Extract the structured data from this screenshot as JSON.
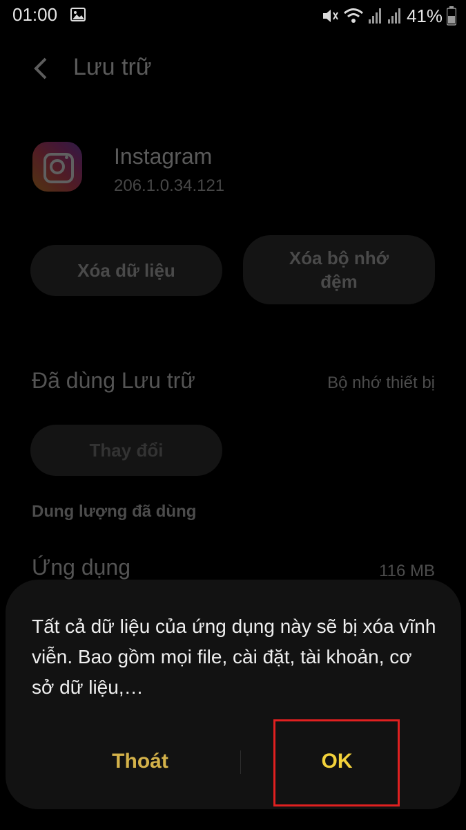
{
  "status_bar": {
    "time": "01:00",
    "battery": "41%",
    "icons": [
      "image-notification-icon",
      "mute-icon",
      "wifi-icon",
      "signal-icon",
      "signal-icon",
      "battery-icon"
    ]
  },
  "header": {
    "title": "Lưu trữ",
    "back_icon": "back-arrow-icon"
  },
  "app": {
    "name": "Instagram",
    "version": "206.1.0.34.121"
  },
  "actions": {
    "clear_data": "Xóa dữ liệu",
    "clear_cache": "Xóa bộ nhớ\nđệm"
  },
  "storage": {
    "used_label": "Đã dùng Lưu trữ",
    "location": "Bộ nhớ thiết bị",
    "change_button": "Thay đổi",
    "section_header": "Dung lượng đã dùng",
    "app_label": "Ứng dụng",
    "app_size": "116 MB"
  },
  "dialog": {
    "message": "Tất cả dữ liệu của ứng dụng này sẽ bị xóa vĩnh viễn. Bao gồm mọi file, cài đặt, tài khoản, cơ sở dữ liệu,…",
    "cancel": "Thoát",
    "ok": "OK"
  },
  "colors": {
    "background": "#000000",
    "dialog_bg": "#121212",
    "accent": "#f3d23b",
    "cancel": "#d4b24a",
    "highlight": "#e02020"
  }
}
